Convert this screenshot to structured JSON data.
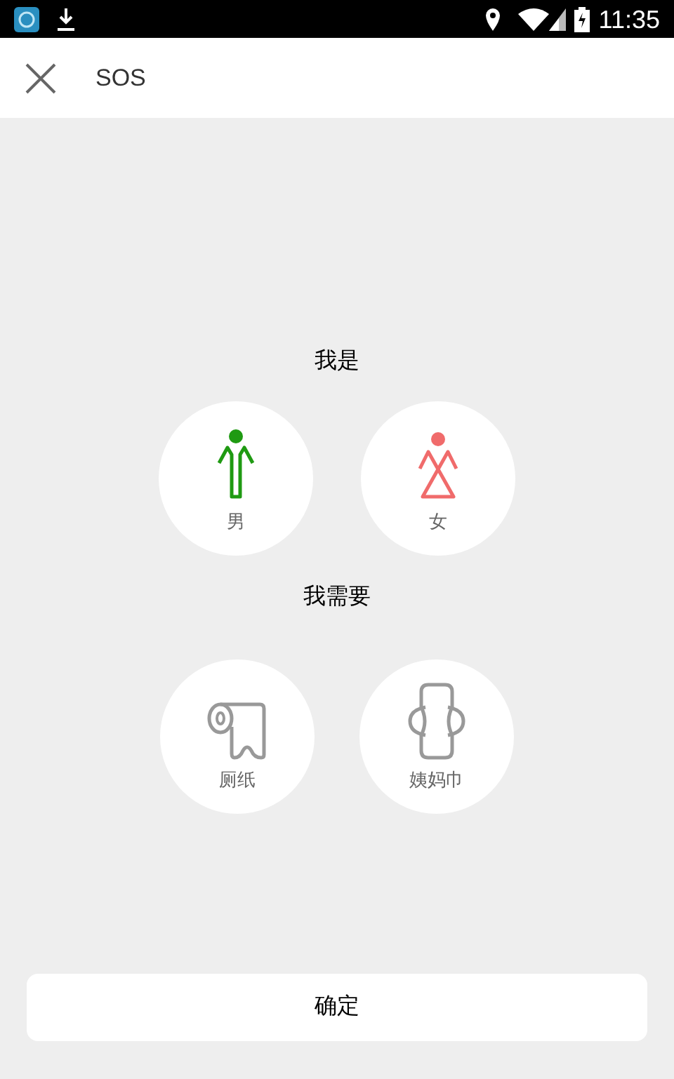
{
  "status_bar": {
    "time": "11:35"
  },
  "header": {
    "title": "SOS"
  },
  "gender_section": {
    "title": "我是",
    "options": [
      {
        "kind": "male",
        "label": "男",
        "color": "#1f9a12"
      },
      {
        "kind": "female",
        "label": "女",
        "color": "#f06b6b"
      }
    ]
  },
  "need_section": {
    "title": "我需要",
    "options": [
      {
        "kind": "toilet_paper",
        "label": "厕纸"
      },
      {
        "kind": "pad",
        "label": "姨妈巾"
      }
    ]
  },
  "confirm_button": {
    "label": "确定"
  }
}
